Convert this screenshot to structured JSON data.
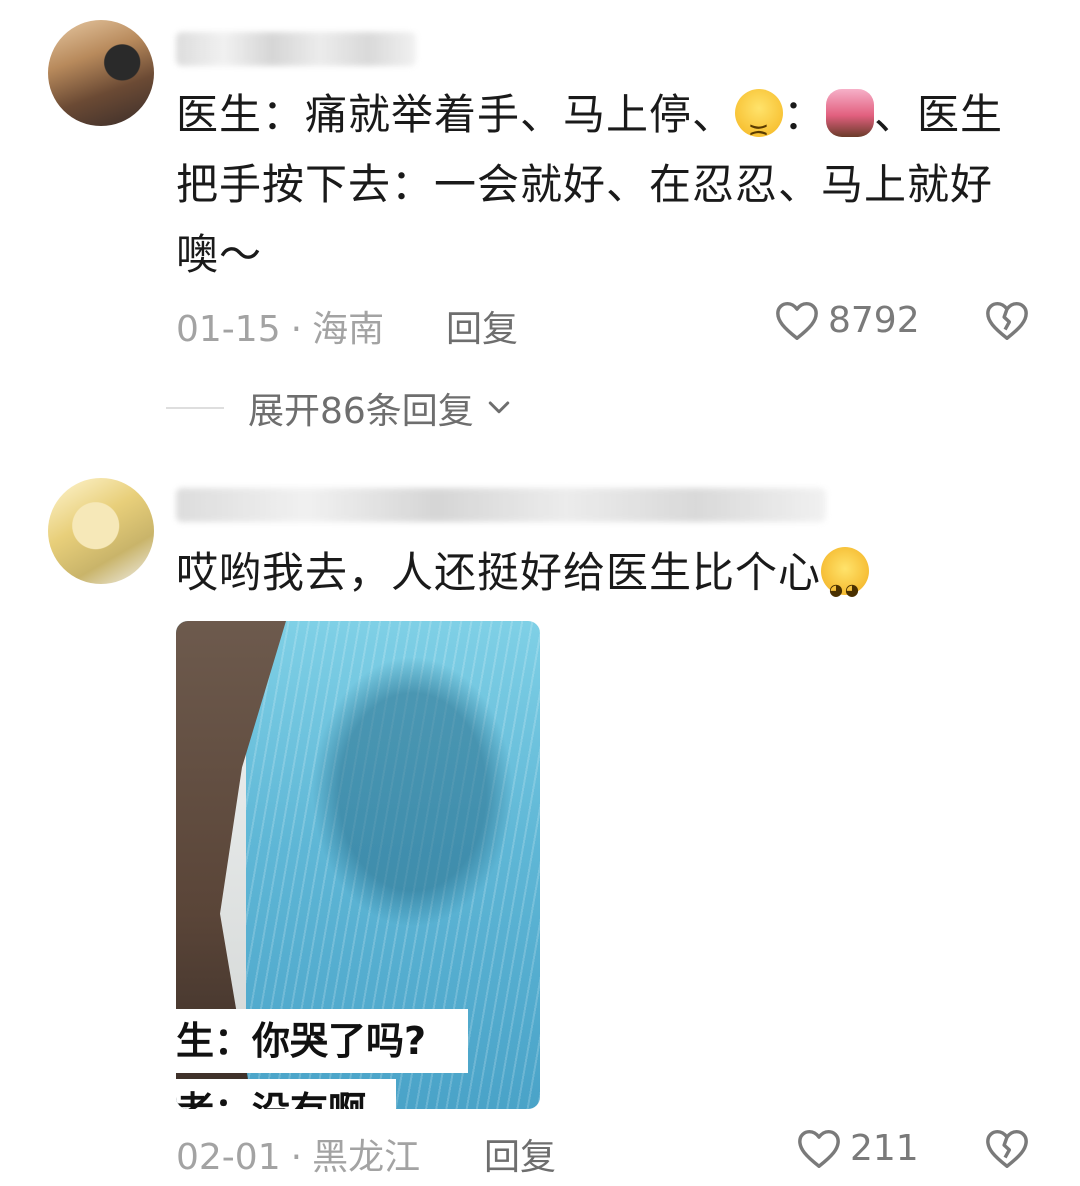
{
  "comments": [
    {
      "text_part1": "医生：痛就举着手、马上停、",
      "text_part2": "：",
      "text_part3": "、医生",
      "text_line2": "把手按下去：一会就好、在忍忍、马上就好",
      "text_line3": "噢～",
      "date": "01-15",
      "location": "海南",
      "reply_label": "回复",
      "likes": "8792",
      "expand_label": "展开86条回复"
    },
    {
      "text": "哎哟我去，人还挺好给医生比个心",
      "media_subtitle_1": "生：你哭了吗?",
      "media_subtitle_2": "者：没有啊",
      "date": "02-01",
      "location": "黑龙江",
      "reply_label": "回复",
      "likes": "211"
    }
  ],
  "meta_separator": "·",
  "icons": {
    "like": "heart-outline-icon",
    "dislike": "broken-heart-icon",
    "expand": "chevron-down-icon"
  },
  "colors": {
    "text": "#1a1a1a",
    "meta": "#a3a3a3",
    "action": "#6e6e6e"
  }
}
